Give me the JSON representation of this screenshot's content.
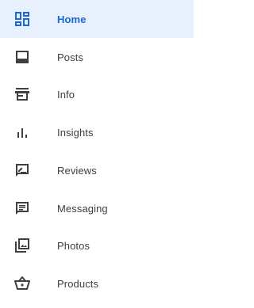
{
  "colors": {
    "active_bg": "#e8f0fe",
    "active_fg": "#1967d2",
    "icon": "#3c4043",
    "text": "#3c4043"
  },
  "nav": {
    "items": [
      {
        "label": "Home",
        "icon": "dashboard-icon",
        "active": true
      },
      {
        "label": "Posts",
        "icon": "posts-icon",
        "active": false
      },
      {
        "label": "Info",
        "icon": "storefront-icon",
        "active": false
      },
      {
        "label": "Insights",
        "icon": "bar-chart-icon",
        "active": false
      },
      {
        "label": "Reviews",
        "icon": "rate-review-icon",
        "active": false
      },
      {
        "label": "Messaging",
        "icon": "message-icon",
        "active": false
      },
      {
        "label": "Photos",
        "icon": "photo-library-icon",
        "active": false
      },
      {
        "label": "Products",
        "icon": "basket-icon",
        "active": false
      }
    ]
  }
}
